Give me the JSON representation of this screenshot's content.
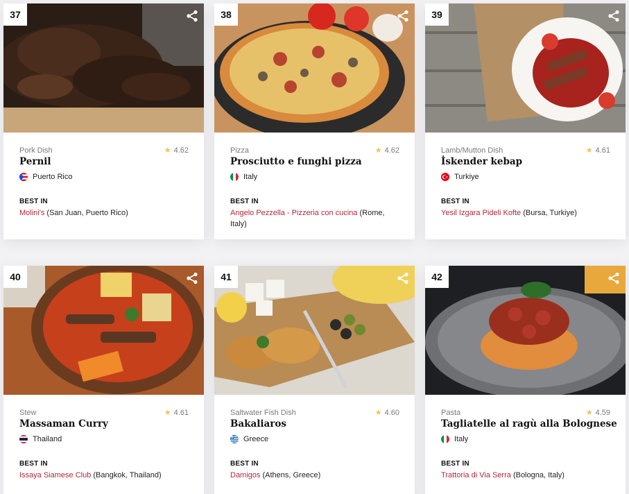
{
  "cards": [
    {
      "rank": "37",
      "category": "Pork Dish",
      "rating": "4.62",
      "name": "Pernil",
      "country": "Puerto Rico",
      "flag": "puerto-rico",
      "best_in_label": "BEST IN",
      "restaurant": "Molini's",
      "location": "(San Juan, Puerto Rico)"
    },
    {
      "rank": "38",
      "category": "Pizza",
      "rating": "4.62",
      "name": "Prosciutto e funghi pizza",
      "country": "Italy",
      "flag": "italy",
      "best_in_label": "BEST IN",
      "restaurant": "Angelo Pezzella - Pizzeria con cucina",
      "location": "(Rome, Italy)"
    },
    {
      "rank": "39",
      "category": "Lamb/Mutton Dish",
      "rating": "4.61",
      "name": "İskender kebap",
      "country": "Turkiye",
      "flag": "turkiye",
      "best_in_label": "BEST IN",
      "restaurant": "Yesil Izgara Pideli Kofte",
      "location": "(Bursa, Turkiye)"
    },
    {
      "rank": "40",
      "category": "Stew",
      "rating": "4.61",
      "name": "Massaman Curry",
      "country": "Thailand",
      "flag": "thailand",
      "best_in_label": "BEST IN",
      "restaurant": "Issaya Siamese Club",
      "location": "(Bangkok, Thailand)"
    },
    {
      "rank": "41",
      "category": "Saltwater Fish Dish",
      "rating": "4.60",
      "name": "Bakaliaros",
      "country": "Greece",
      "flag": "greece",
      "best_in_label": "BEST IN",
      "restaurant": "Damigos",
      "location": "(Athens, Greece)"
    },
    {
      "rank": "42",
      "category": "Pasta",
      "rating": "4.59",
      "name": "Tagliatelle al ragù alla Bolognese",
      "country": "Italy",
      "flag": "italy",
      "best_in_label": "BEST IN",
      "restaurant": "Trattoria di Via Serra",
      "location": "(Bologna, Italy)"
    }
  ],
  "colors": {
    "accent": "#b1283a",
    "star": "#f1c24d"
  },
  "icons": {
    "share": "share-icon",
    "star": "star-icon"
  }
}
